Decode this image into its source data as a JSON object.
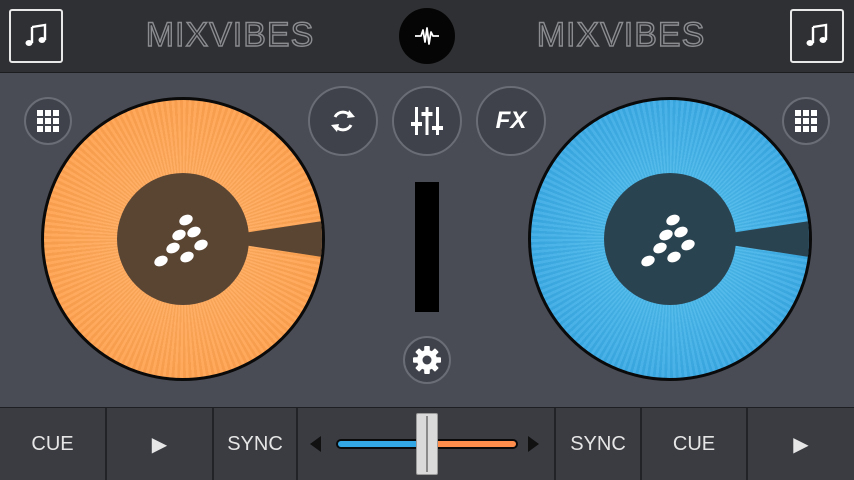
{
  "topbar": {
    "left_brand": "MIXVIBES",
    "right_brand": "MIXVIBES",
    "left_library_icon": "music-note-icon",
    "right_library_icon": "music-note-icon",
    "center_icon": "waveform-icon"
  },
  "controls": {
    "loop_icon": "sync-loop-icon",
    "mixer_icon": "mixer-sliders-icon",
    "fx_label": "FX",
    "settings_icon": "gear-icon",
    "grid_icon": "grid-icon"
  },
  "decks": {
    "left_color": "#ff9c45",
    "right_color": "#2fa0e0"
  },
  "bottom": {
    "left_cue": "CUE",
    "left_play": "▶",
    "left_sync": "SYNC",
    "right_sync": "SYNC",
    "right_cue": "CUE",
    "right_play": "▶",
    "crossfader_position": 0.5,
    "crossfader_left_color": "#33a7e3",
    "crossfader_right_color": "#ff8d4b"
  }
}
